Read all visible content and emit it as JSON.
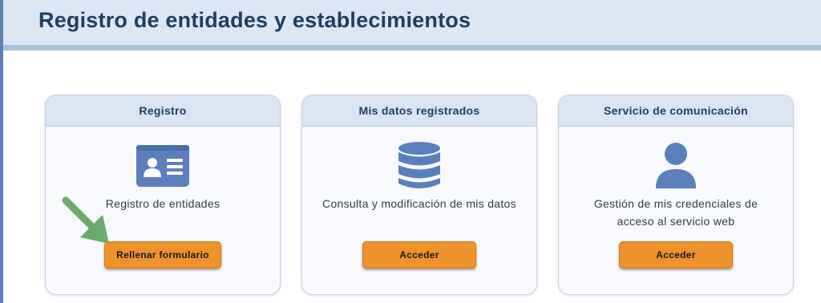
{
  "header": {
    "title": "Registro de entidades y establecimientos"
  },
  "cards": [
    {
      "title": "Registro",
      "icon": "id-card-icon",
      "description": "Registro de entidades",
      "button_label": "Rellenar formulario"
    },
    {
      "title": "Mis datos registrados",
      "icon": "database-icon",
      "description": "Consulta y modificación de mis datos",
      "button_label": "Acceder"
    },
    {
      "title": "Servicio de comunicación",
      "icon": "user-icon",
      "description": "Gestión de mis credenciales de acceso al servicio web",
      "button_label": "Acceder"
    }
  ],
  "annotation": {
    "icon": "pointer-arrow-icon"
  },
  "colors": {
    "accent": "#ee922c",
    "icon": "#5b7fbc",
    "title": "#1f3e63",
    "header_bg": "#dce6f4",
    "arrow": "#6aaa6a"
  }
}
